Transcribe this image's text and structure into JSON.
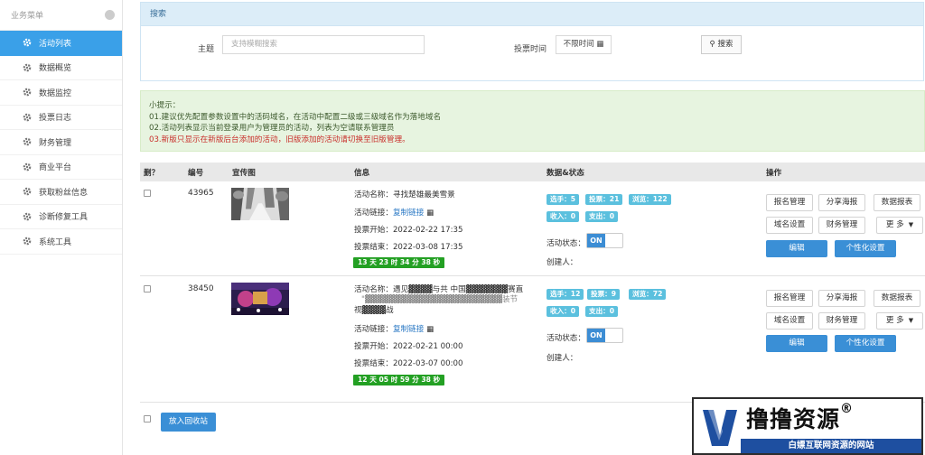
{
  "sidebar": {
    "header": "业务菜单",
    "items": [
      {
        "label": "活动列表",
        "active": true
      },
      {
        "label": "数据概览"
      },
      {
        "label": "数据监控"
      },
      {
        "label": "投票日志"
      },
      {
        "label": "财务管理"
      },
      {
        "label": "商业平台"
      },
      {
        "label": "获取粉丝信息"
      },
      {
        "label": "诊断修复工具"
      },
      {
        "label": "系统工具"
      }
    ]
  },
  "search": {
    "title": "搜索",
    "subject_label": "主题",
    "subject_placeholder": "支持模糊搜索",
    "time_label": "投票时间",
    "time_value": "不限时间",
    "button": "搜索"
  },
  "tips": {
    "heading": "小提示：",
    "line1": "01.建议优先配置参数设置中的活码域名，在活动中配置二级或三级域名作为落地域名",
    "line2": "02.活动列表显示当前登录用户为管理员的活动，列表为空请联系管理员",
    "line3": "03.新版只显示在新版后台添加的活动，旧版添加的活动请切换至旧版管理。"
  },
  "table": {
    "headers": {
      "del": "删？",
      "id": "编号",
      "image": "宣传图",
      "info": "信息",
      "stats": "数据&状态",
      "ops": "操作"
    },
    "rows": [
      {
        "id": "43965",
        "name_label": "活动名称：",
        "name": "寻找楚雄最美雪景",
        "link_label": "活动链接：",
        "link_text": "复制链接",
        "start": "投票开始：2022-02-22 17:35",
        "end": "投票结束：2022-03-08 17:35",
        "countdown": "13 天 23 时 34 分 38 秒",
        "stats": [
          "选手：5",
          "投票：21",
          "浏览：122",
          "收入：0",
          "支出：0"
        ],
        "status_label": "活动状态：",
        "toggle": "ON",
        "creator": "创建人："
      },
      {
        "id": "38450",
        "name_label": "活动名称：",
        "name": "遇见▓▓▓▓与共 中国▓▓▓▓▓▓▓赛直",
        "name2": "\"▓▓▓▓▓▓▓▓▓▓▓▓▓▓▓▓▓▓▓▓▓▓▓装节",
        "name3": "视▓▓▓▓战",
        "link_label": "活动链接：",
        "link_text": "复制链接",
        "start": "投票开始：2022-02-21 00:00",
        "end": "投票结束：2022-03-07 00:00",
        "countdown": "12 天 05 时 59 分 38 秒",
        "stats": [
          "选手：12",
          "投票：9",
          "浏览：72",
          "收入：0",
          "支出：0"
        ],
        "status_label": "活动状态：",
        "toggle": "ON",
        "creator": "创建人："
      }
    ],
    "ops": {
      "signup": "报名管理",
      "poster": "分享海报",
      "report": "数据报表",
      "domain": "域名设置",
      "finance": "财务管理",
      "more": "更 多",
      "edit": "编辑",
      "personalize": "个性化设置"
    }
  },
  "recycle_button": "放入回收站",
  "watermark": {
    "title": "撸撸资源",
    "registered": "®",
    "subtitle": "白嫖互联网资源的网站"
  },
  "colors": {
    "accent": "#3a8fd6",
    "sidebar_active": "#3aa0e8",
    "countdown": "#23a023",
    "badge": "#5bc0de",
    "tip_red": "#c9302c"
  }
}
